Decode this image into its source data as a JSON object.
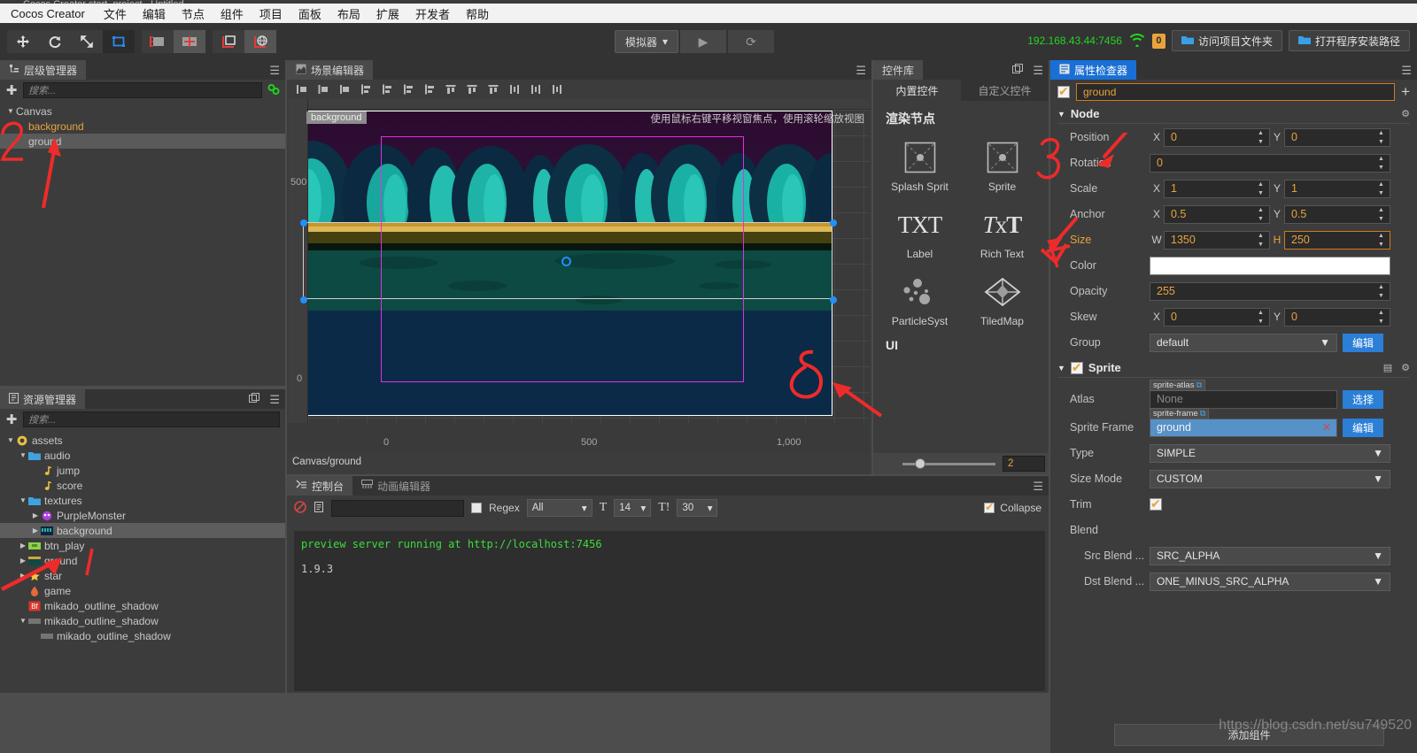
{
  "window": {
    "title": "Cocos Creator  start_project - Untitled"
  },
  "menu": {
    "brand": "Cocos Creator",
    "items": [
      "文件",
      "编辑",
      "节点",
      "组件",
      "项目",
      "面板",
      "布局",
      "扩展",
      "开发者",
      "帮助"
    ]
  },
  "toolbar": {
    "tools": [
      {
        "name": "move-tool",
        "glyph": "✥"
      },
      {
        "name": "rotate-tool",
        "glyph": "⟳"
      },
      {
        "name": "scale-tool",
        "glyph": "⤧"
      },
      {
        "name": "rect-tool",
        "glyph": "▣"
      }
    ],
    "snap_tools": [
      {
        "name": "grid-snap-tool",
        "glyph": "▦"
      },
      {
        "name": "align-snap-tool",
        "glyph": "✛"
      }
    ],
    "pivot_tools": [
      {
        "name": "pivot-tool",
        "glyph": "⌐"
      },
      {
        "name": "global-coord-tool",
        "glyph": "◍"
      }
    ],
    "simulator_label": "模拟器",
    "play_label": "▶",
    "reload_label": "⟳",
    "ip_address": "192.168.43.44:7456",
    "wifi_icon": "wifi-icon",
    "message_count": "0",
    "open_project_folder": "访问项目文件夹",
    "open_install_path": "打开程序安装路径"
  },
  "hierarchy": {
    "tab_title": "层级管理器",
    "search_placeholder": "搜索...",
    "nodes": [
      {
        "label": "Canvas",
        "depth": 0,
        "expander": "d",
        "color": "normal",
        "selected": false
      },
      {
        "label": "background",
        "depth": 1,
        "expander": "none",
        "color": "orange",
        "selected": false
      },
      {
        "label": "ground",
        "depth": 1,
        "expander": "none",
        "color": "normal",
        "selected": true
      }
    ]
  },
  "assets": {
    "tab_title": "资源管理器",
    "search_placeholder": "搜索...",
    "nodes": [
      {
        "label": "assets",
        "depth": 0,
        "expander": "d",
        "icon": "assets-icon",
        "selected": false
      },
      {
        "label": "audio",
        "depth": 1,
        "expander": "d",
        "icon": "folder-icon",
        "selected": false
      },
      {
        "label": "jump",
        "depth": 2,
        "expander": "none",
        "icon": "audio-icon",
        "selected": false
      },
      {
        "label": "score",
        "depth": 2,
        "expander": "none",
        "icon": "audio-icon",
        "selected": false
      },
      {
        "label": "textures",
        "depth": 1,
        "expander": "d",
        "icon": "folder-icon",
        "selected": false
      },
      {
        "label": "PurpleMonster",
        "depth": 2,
        "expander": "r",
        "icon": "monster-icon",
        "selected": false
      },
      {
        "label": "background",
        "depth": 2,
        "expander": "r",
        "icon": "texture-bg-icon",
        "selected": true
      },
      {
        "label": "btn_play",
        "depth": 1,
        "expander": "r",
        "icon": "texture-btn-icon",
        "selected": false
      },
      {
        "label": "ground",
        "depth": 1,
        "expander": "r",
        "icon": "texture-ground-icon",
        "selected": false
      },
      {
        "label": "star",
        "depth": 1,
        "expander": "r",
        "icon": "star-icon",
        "selected": false
      },
      {
        "label": "game",
        "depth": 1,
        "expander": "none",
        "icon": "script-icon",
        "selected": false
      },
      {
        "label": "mikado_outline_shadow",
        "depth": 1,
        "expander": "none",
        "icon": "bf-icon",
        "selected": false
      },
      {
        "label": "mikado_outline_shadow",
        "depth": 1,
        "expander": "d",
        "icon": "font-icon",
        "selected": false
      },
      {
        "label": "mikado_outline_shadow",
        "depth": 2,
        "expander": "none",
        "icon": "font-icon",
        "selected": false
      }
    ]
  },
  "scene": {
    "tab_title": "场景编辑器",
    "align_buttons": [
      "▯",
      "◫",
      "◪",
      "⊢",
      "⊥",
      "⊣",
      "|",
      "⊤",
      "⊦",
      "⊧",
      "⫿",
      "⫾",
      "⫽"
    ],
    "node_badge": "background",
    "hint": "使用鼠标右键平移视窗焦点，使用滚轮缩放视图",
    "ruler_y_ticks": [
      "500",
      "0"
    ],
    "ruler_x_ticks": [
      "0",
      "500",
      "1,000"
    ],
    "status": "Canvas/ground"
  },
  "library": {
    "tab_title": "控件库",
    "tabs": [
      {
        "label": "内置控件",
        "active": true
      },
      {
        "label": "自定义控件",
        "active": false
      }
    ],
    "sections": [
      {
        "title": "渲染节点",
        "items": [
          {
            "label": "Splash Sprit",
            "icon": "sprite-icon"
          },
          {
            "label": "Sprite",
            "icon": "sprite-icon"
          },
          {
            "label": "Label",
            "icon": "label-txt-icon"
          },
          {
            "label": "Rich Text",
            "icon": "richtext-icon"
          },
          {
            "label": "ParticleSyst",
            "icon": "particle-icon"
          },
          {
            "label": "TiledMap",
            "icon": "tiledmap-icon"
          }
        ]
      },
      {
        "title": "UI",
        "items": []
      }
    ],
    "zoom_value": "2"
  },
  "console": {
    "tabs": [
      {
        "label": "控制台",
        "icon": "console-icon",
        "active": true
      },
      {
        "label": "动画编辑器",
        "icon": "animation-icon",
        "active": false
      }
    ],
    "clear_icon": "clear-icon",
    "copy_icon": "copy-icon",
    "filter_value": "",
    "regex_label": "Regex",
    "regex_checked": false,
    "level_filter": "All",
    "font_icon_1": "T",
    "font_size": "14",
    "font_icon_2": "T!",
    "line_count": "30",
    "collapse_label": "Collapse",
    "collapse_checked": true,
    "logs": [
      {
        "text": "preview server running at http://localhost:7456",
        "level": "green"
      },
      {
        "text": "1.9.3",
        "level": "gray"
      }
    ]
  },
  "inspector": {
    "tab_title": "属性检查器",
    "node_enabled": true,
    "node_name": "ground",
    "add_icon": "+",
    "node_section": {
      "title": "Node",
      "gear_icon": "gear-icon",
      "position": {
        "label": "Position",
        "x": "0",
        "y": "0"
      },
      "rotation": {
        "label": "Rotation",
        "value": "0"
      },
      "scale": {
        "label": "Scale",
        "x": "1",
        "y": "1"
      },
      "anchor": {
        "label": "Anchor",
        "x": "0.5",
        "y": "0.5"
      },
      "size": {
        "label": "Size",
        "w": "1350",
        "h": "250"
      },
      "color": {
        "label": "Color",
        "value": "#ffffff"
      },
      "opacity": {
        "label": "Opacity",
        "value": "255"
      },
      "skew": {
        "label": "Skew",
        "x": "0",
        "y": "0"
      },
      "group": {
        "label": "Group",
        "value": "default",
        "button": "编辑"
      }
    },
    "sprite_section": {
      "title": "Sprite",
      "enabled": true,
      "atlas": {
        "label": "Atlas",
        "tag": "sprite-atlas",
        "value": "None",
        "button": "选择"
      },
      "sprite_frame": {
        "label": "Sprite Frame",
        "tag": "sprite-frame",
        "value": "ground",
        "button": "编辑"
      },
      "type": {
        "label": "Type",
        "value": "SIMPLE"
      },
      "size_mode": {
        "label": "Size Mode",
        "value": "CUSTOM"
      },
      "trim": {
        "label": "Trim",
        "checked": true
      },
      "blend": {
        "label": "Blend"
      },
      "src_blend": {
        "label": "Src Blend ...",
        "value": "SRC_ALPHA"
      },
      "dst_blend": {
        "label": "Dst Blend ...",
        "value": "ONE_MINUS_SRC_ALPHA"
      }
    },
    "add_component": "添加组件",
    "watermark": "https://blog.csdn.net/su749520"
  },
  "annotations": [
    {
      "name": "annotation-2",
      "text": "2"
    },
    {
      "name": "annotation-3",
      "text": "3"
    },
    {
      "name": "annotation-4",
      "text": "4"
    },
    {
      "name": "annotation-5",
      "text": "5"
    },
    {
      "name": "annotation-1",
      "text": "1"
    }
  ],
  "colors": {
    "accent_orange": "#e8a33d",
    "accent_blue": "#2b7fd6",
    "annotation_red": "#ee2b2b",
    "log_green": "#3ddb3d",
    "selection_magenta": "#e030e0"
  }
}
